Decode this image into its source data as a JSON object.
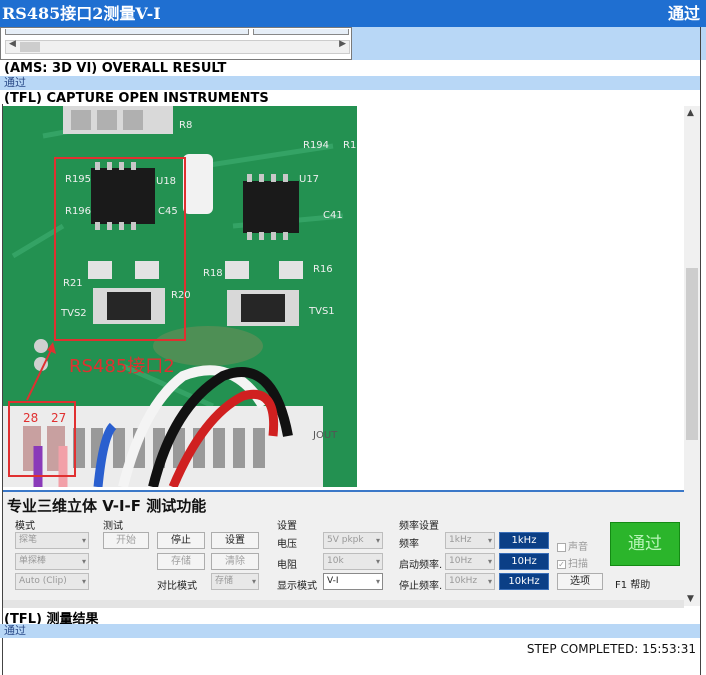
{
  "title": "RS485接口2测量V-I",
  "title_status": "通过",
  "sections": [
    {
      "heading": "(AMS: 3D VI) OVERALL RESULT",
      "result": "通过"
    },
    {
      "heading": "(TFL) CAPTURE OPEN INSTRUMENTS"
    },
    {
      "heading": "(TFL) 测量结果",
      "result": "通过"
    }
  ],
  "photo": {
    "annotation": "RS485接口2",
    "pins": [
      "28",
      "27"
    ],
    "silkscreen": [
      "R8",
      "R194",
      "R1",
      "U18",
      "R195",
      "R196",
      "C45",
      "U17",
      "C41",
      "R21",
      "R20",
      "R18",
      "R16",
      "TVS2",
      "TVS1",
      "JOUT"
    ]
  },
  "panel": {
    "title": "专业三维立体 V-I-F 测试功能",
    "mode": {
      "label": "模式",
      "probe": "探笔",
      "single_probe": "单探棒",
      "auto_clip": "Auto (Clip)"
    },
    "test": {
      "label": "测试",
      "start": "开始",
      "stop": "停止",
      "settings": "设置",
      "store": "存储",
      "clear": "清除",
      "compare_mode": "对比模式",
      "storage": "存储"
    },
    "setup": {
      "label": "设置",
      "voltage_label": "电压",
      "voltage": "5V pkpk",
      "resistance_label": "电阻",
      "resistance": "10k",
      "display_mode_label": "显示模式",
      "display_mode": "V-I"
    },
    "freq": {
      "label": "频率设置",
      "freq_label": "频率",
      "freq": "1kHz",
      "freq_value": "1kHz",
      "start_label": "启动频率.",
      "start": "10Hz",
      "start_value": "10Hz",
      "stop_label": "停止频率.",
      "stop": "10kHz",
      "stop_value": "10kHz",
      "sound": "声音",
      "scan": "扫描",
      "options": "选项"
    },
    "pass_button": "通过",
    "help": "F1 帮助"
  },
  "footer": "STEP COMPLETED: 15:53:31",
  "colors": {
    "title_bg": "#1f6fd1",
    "band": "#b8d7f6",
    "pass_green": "#2bb52b",
    "freq_blue": "#0b3f86"
  }
}
